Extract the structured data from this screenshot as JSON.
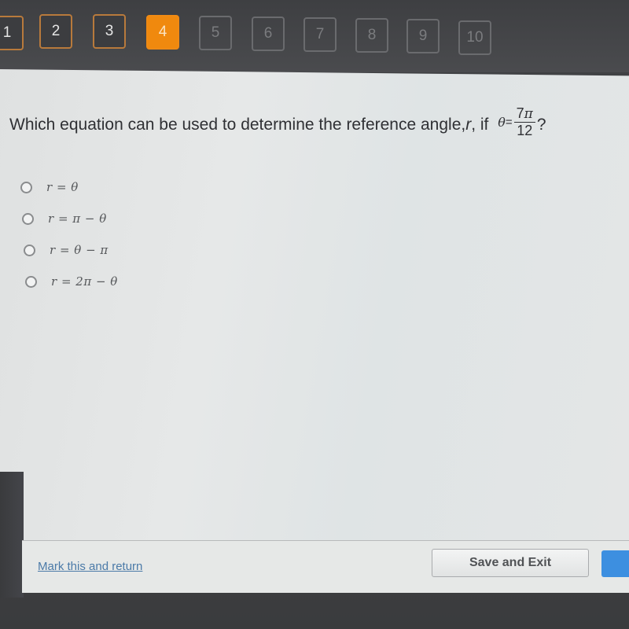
{
  "navigation": {
    "questions": [
      {
        "label": "1",
        "state": "visited"
      },
      {
        "label": "2",
        "state": "visited"
      },
      {
        "label": "3",
        "state": "visited"
      },
      {
        "label": "4",
        "state": "current"
      },
      {
        "label": "5",
        "state": "unvisited"
      },
      {
        "label": "6",
        "state": "unvisited"
      },
      {
        "label": "7",
        "state": "unvisited"
      },
      {
        "label": "8",
        "state": "unvisited"
      },
      {
        "label": "9",
        "state": "unvisited"
      },
      {
        "label": "10",
        "state": "unvisited"
      }
    ],
    "current_question": 4,
    "colors": {
      "current": "#f0890e",
      "visited_border": "#b87a3c",
      "unvisited_border": "#6a6b6e"
    }
  },
  "question": {
    "text_before": "Which equation can be used to determine the reference angle, ",
    "variable_r": "r",
    "text_after": ", if ",
    "theta": "θ",
    "equals": "=",
    "fraction_numerator_number": "7",
    "fraction_numerator_symbol": "π",
    "fraction_denominator": "12",
    "end_mark": "?"
  },
  "options": [
    {
      "label": "r = θ"
    },
    {
      "label": "r = π − θ"
    },
    {
      "label": "r = θ − π"
    },
    {
      "label": "r = 2π − θ"
    }
  ],
  "footer": {
    "mark_link": "Mark this and return",
    "save_button": "Save and Exit",
    "next_button": "",
    "link_color": "#4b7aa8",
    "next_button_color": "#3d8fe0"
  }
}
